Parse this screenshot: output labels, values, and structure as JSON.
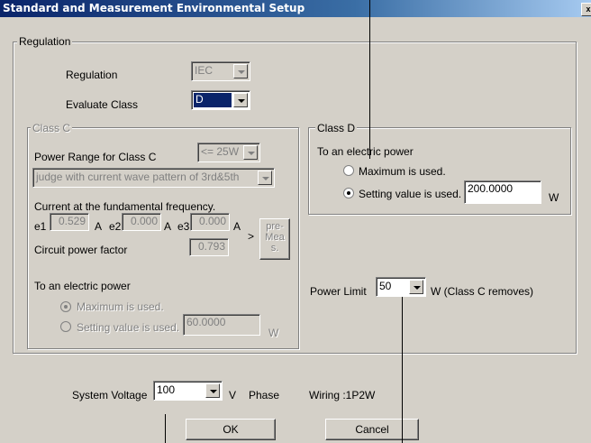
{
  "window": {
    "title": "Standard and Measurement Environmental Setup",
    "close_glyph": "x"
  },
  "regulation_group": {
    "legend": "Regulation",
    "regulation_label": "Regulation",
    "regulation_value": "IEC",
    "evaluate_label": "Evaluate Class",
    "evaluate_value": "D"
  },
  "class_c": {
    "legend": "Class C",
    "power_range_label": "Power Range for Class C",
    "power_range_value": "<= 25W",
    "judge_value": "judge with current wave pattern of 3rd&5th",
    "current_label": "Current at the fundamental frequency.",
    "e1_label": "e1",
    "e1_value": "0.529",
    "e1_unit": "A",
    "e2_label": "e2",
    "e2_value": "0.000",
    "e2_unit": "A",
    "e3_label": "e3",
    "e3_value": "0.000",
    "e3_unit": "A",
    "arrow": ">",
    "pre_meas_label": "pre-\nMea\ns.",
    "pf_label": "Circuit power factor",
    "pf_value": "0.793",
    "electric_label": "To an electric power",
    "max_label": "Maximum is used.",
    "setting_label": "Setting value is used.",
    "setting_value": "60.0000",
    "setting_unit": "W"
  },
  "class_d": {
    "legend": "Class D",
    "electric_label": "To an electric power",
    "max_label": "Maximum is used.",
    "setting_label": "Setting value is used.",
    "setting_value": "200.0000",
    "setting_unit": "W"
  },
  "power_limit": {
    "label": "Power Limit",
    "value": "50",
    "unit": "W (Class C removes)"
  },
  "bottom": {
    "system_voltage_label": "System Voltage",
    "system_voltage_value": "100",
    "voltage_unit": "V",
    "phase_label": "Phase",
    "wiring_label": "Wiring :1P2W",
    "ok_label": "OK",
    "cancel_label": "Cancel"
  }
}
